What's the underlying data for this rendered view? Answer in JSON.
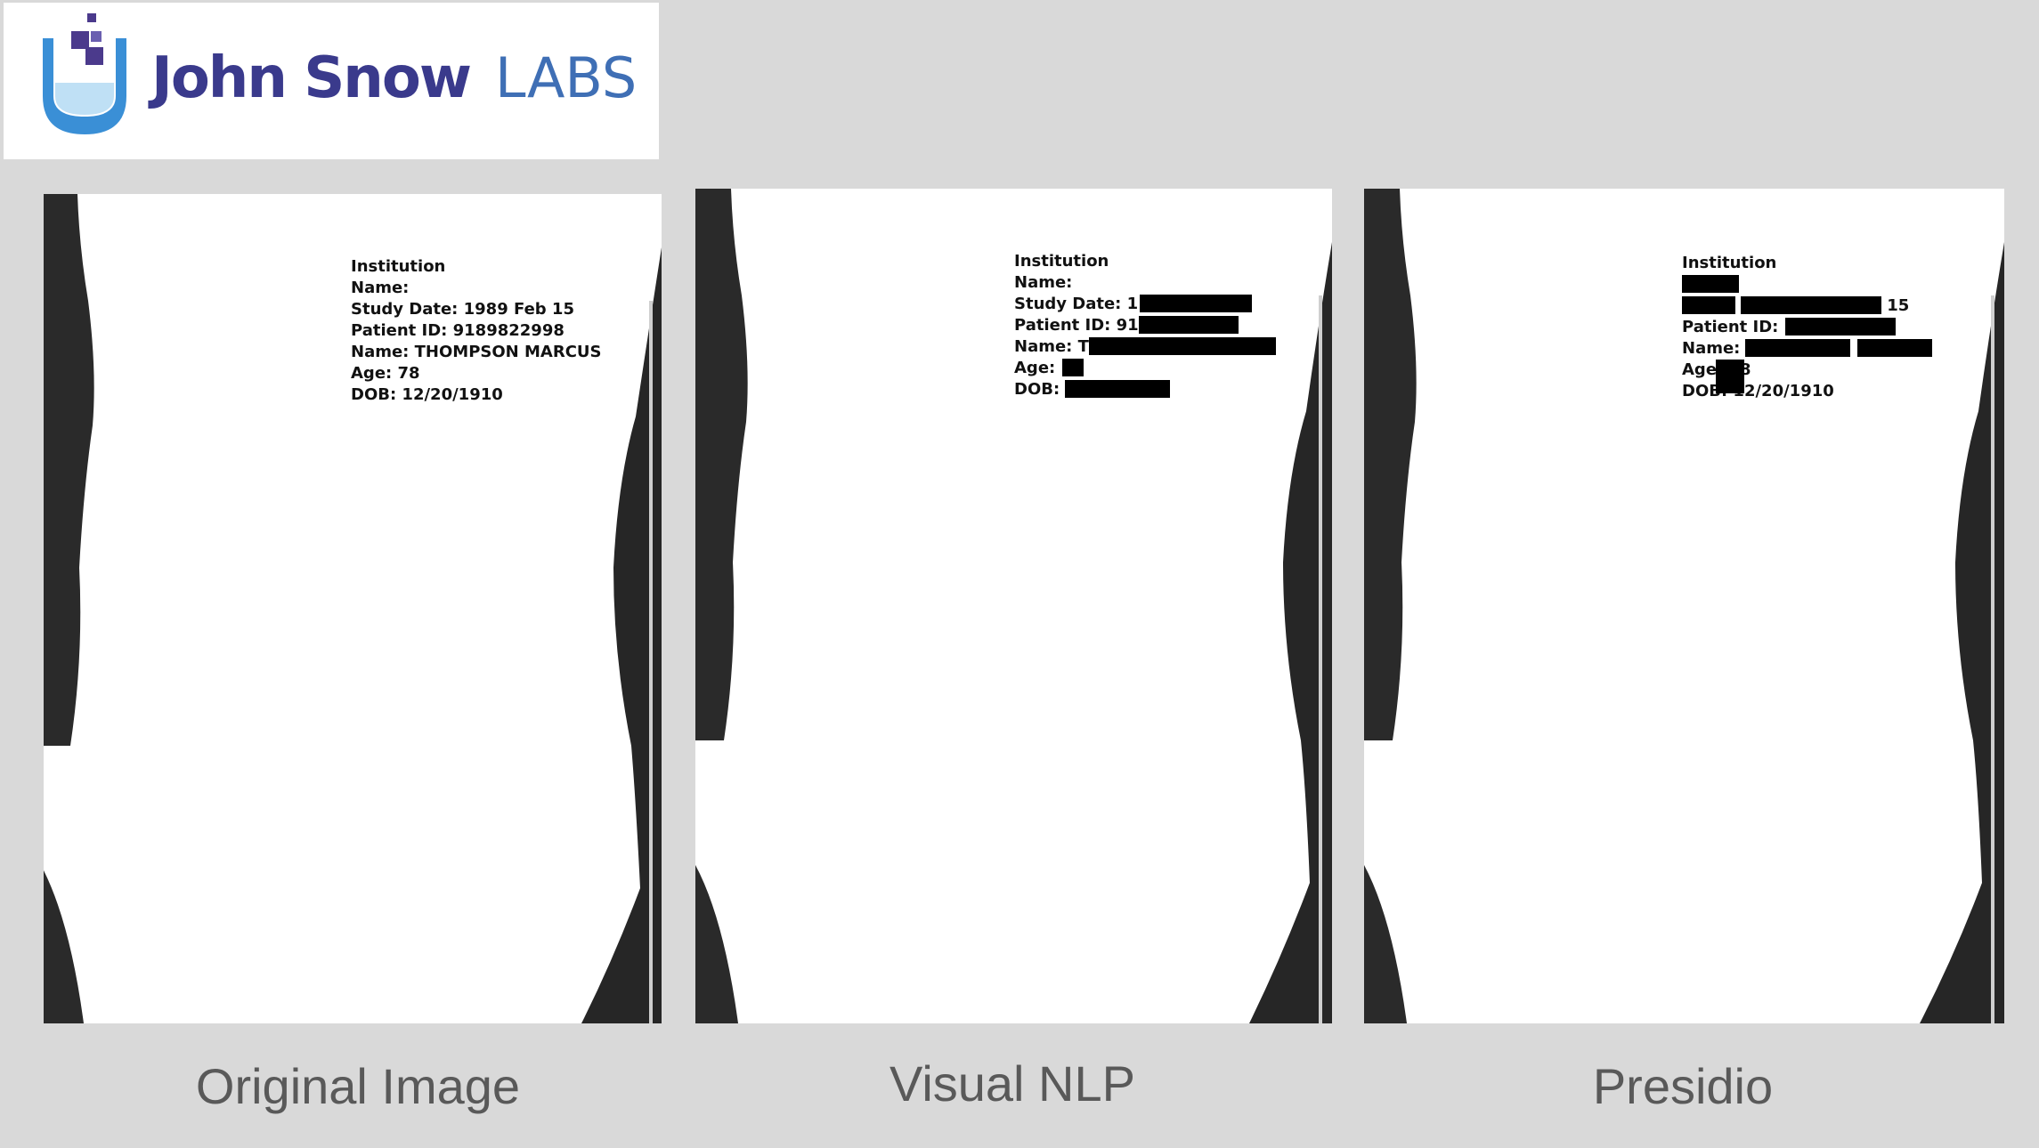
{
  "logo": {
    "brand": "John Snow",
    "labs": "LABS",
    "icon": "test-tube-logo-icon",
    "colors": {
      "brand": "#3a3a8c",
      "labs": "#3f6fb5",
      "tube": "#3a8fd6",
      "pixel": "#4b3a8c"
    }
  },
  "panels": {
    "original": {
      "caption": "Original Image",
      "lines": {
        "institution": "Institution",
        "name_label": "Name:",
        "study_date": "Study Date: 1989 Feb 15",
        "patient_id": "Patient ID: 9189822998",
        "name": "Name: THOMPSON MARCUS",
        "age": "Age: 78",
        "dob": "DOB: 12/20/1910"
      }
    },
    "visual_nlp": {
      "caption": "Visual NLP",
      "lines": {
        "institution": "Institution",
        "name_label": "Name:",
        "study_date": "Study Date: 1",
        "patient_id": "Patient ID: 91",
        "name": "Name: T",
        "age": "Age:",
        "dob": "DOB:"
      }
    },
    "presidio": {
      "caption": "Presidio",
      "lines": {
        "institution": "Institution",
        "study_suffix": "15",
        "patient_id": "Patient ID:",
        "name": "Name:",
        "age_prefix": "Age",
        "age_suffix": "8",
        "dob": "DOB: 12/20/1910"
      }
    }
  },
  "colors": {
    "background": "#d9d9d9",
    "redaction": "#000000",
    "caption": "#595959"
  }
}
